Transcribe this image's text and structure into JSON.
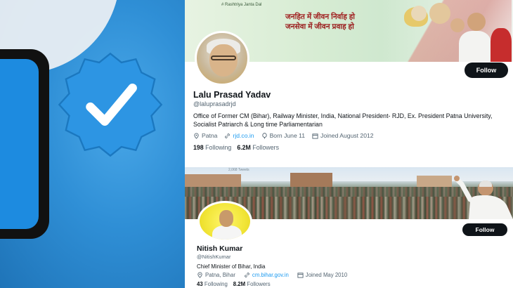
{
  "left_panel": {
    "badge_icon": "verified-badge-icon",
    "badge_color": "#2d95e3",
    "device_icon": "phone-icon"
  },
  "profile1": {
    "banner": {
      "tag": "# Rashtriya Janta Dal",
      "slogan_line1": "जनहित में जीवन निर्वाह हो",
      "slogan_line2": "जनसेवा में जीवन प्रवाह हो"
    },
    "follow_label": "Follow",
    "name": "Lalu Prasad Yadav",
    "handle": "@laluprasadrjd",
    "bio": "Office of Former CM (Bihar), Railway Minister, India, National President- RJD, Ex. President Patna University, Socialist Patriarch & Long time Parliamentarian",
    "location": "Patna",
    "website": "rjd.co.in",
    "birthday": "Born June 11",
    "joined": "Joined August 2012",
    "following_count": "198",
    "following_label": "Following",
    "followers_count": "6.2M",
    "followers_label": "Followers"
  },
  "profile2": {
    "banner_tiny_text": "2,068 Tweets",
    "follow_label": "Follow",
    "name": "Nitish Kumar",
    "handle": "@NitishKumar",
    "bio": "Chief Minister of Bihar, India",
    "location": "Patna, Bihar",
    "website": "cm.bihar.gov.in",
    "joined": "Joined May 2010",
    "following_count": "43",
    "following_label": "Following",
    "followers_count": "8.2M",
    "followers_label": "Followers"
  },
  "colors": {
    "link": "#1d9bf0",
    "muted": "#536471",
    "text": "#0f1419",
    "follow_bg": "#0f1419"
  }
}
